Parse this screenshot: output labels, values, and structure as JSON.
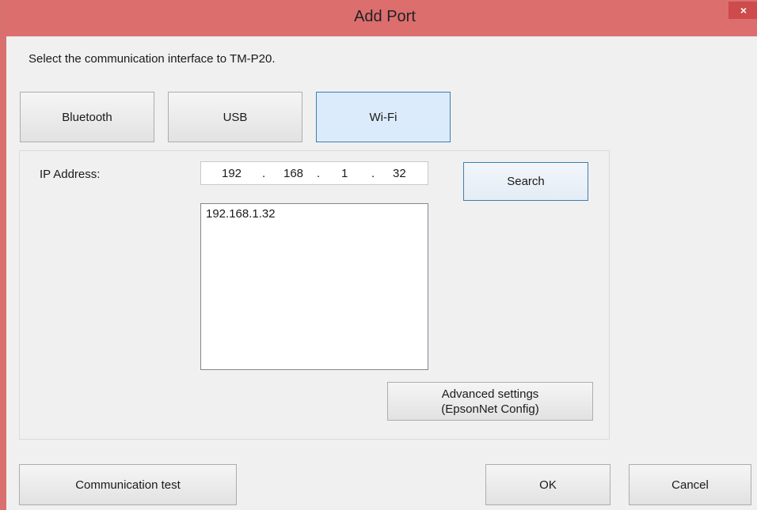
{
  "window": {
    "title": "Add Port",
    "close_glyph": "×",
    "accent_color": "#dc6e6e"
  },
  "instruction": "Select the communication interface to TM-P20.",
  "interface_tabs": [
    {
      "label": "Bluetooth",
      "selected": false
    },
    {
      "label": "USB",
      "selected": false
    },
    {
      "label": "Wi-Fi",
      "selected": true
    }
  ],
  "wifi": {
    "ip_label": "IP Address:",
    "ip_octets": [
      "192",
      "168",
      "1",
      "32"
    ],
    "ip_separator": ".",
    "search_label": "Search",
    "results": [
      "192.168.1.32"
    ],
    "advanced_label_line1": "Advanced settings",
    "advanced_label_line2": "(EpsonNet Config)"
  },
  "footer": {
    "comm_test_label": "Communication test",
    "ok_label": "OK",
    "cancel_label": "Cancel"
  }
}
